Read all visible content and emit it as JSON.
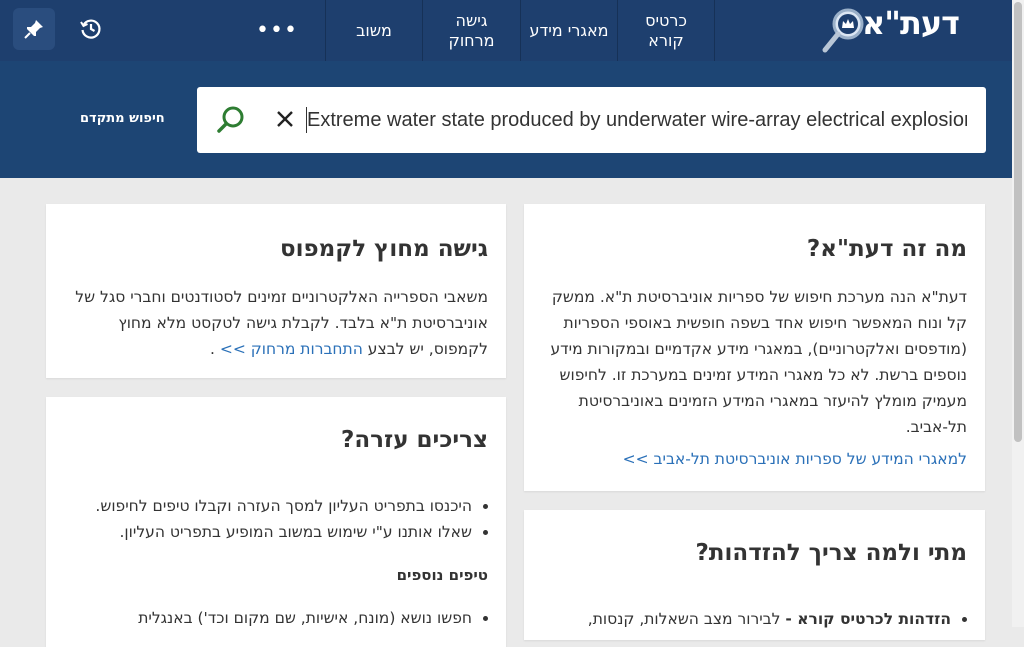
{
  "header": {
    "logo_text": "דעת\"א",
    "nav": [
      {
        "label_line1": "כרטיס",
        "label_line2": "קורא"
      },
      {
        "label_line1": "מאגרי מידע",
        "label_line2": ""
      },
      {
        "label_line1": "גישה",
        "label_line2": "מרחוק"
      },
      {
        "label_line1": "משוב",
        "label_line2": ""
      }
    ],
    "more_label": "•••",
    "icons": {
      "pin": "pin-icon",
      "history": "history-icon",
      "logo": "magnifier-crown-icon"
    }
  },
  "search": {
    "value": "Extreme water state produced by underwater wire-array electrical explosion",
    "advanced_label": "חיפוש מתקדם",
    "go_icon": "search-icon",
    "clear_icon": "close-icon",
    "go_color": "#2e7d32"
  },
  "cards": {
    "about": {
      "title": "מה זה דעת\"א?",
      "lines": [
        "דעת\"א הנה מערכת חיפוש של ספריות אוניברסיטת ת\"א. ממשק",
        "קל ונוח המאפשר חיפוש אחד בשפה חופשית באוספי הספריות",
        "(מודפסים ואלקטרוניים), במאגרי מידע אקדמיים ובמקורות מידע",
        "נוספים ברשת. לא כל מאגרי המידע זמינים במערכת זו. לחיפוש",
        "מעמיק מומלץ להיעזר במאגרי המידע הזמינים באוניברסיטת",
        "תל-אביב."
      ],
      "link": "למאגרי המידע של ספריות אוניברסיטת תל-אביב >>"
    },
    "remote": {
      "title": "גישה מחוץ לקמפוס",
      "line1": "משאבי הספרייה האלקטרוניים זמינים לסטודנטים וחברי סגל של",
      "line2": "אוניברסיטת ת\"א בלבד. לקבלת גישה לטקסט מלא מחוץ",
      "line3_prefix": "לקמפוס, יש לבצע",
      "line3_link": "התחברות מרחוק >>",
      "line3_suffix": "."
    },
    "help": {
      "title": "צריכים עזרה?",
      "items": [
        "היכנסו בתפריט העליון למסך העזרה וקבלו טיפים לחיפוש.",
        "שאלו אותנו ע\"י שימוש במשוב המופיע בתפריט העליון."
      ],
      "tips_title": "טיפים נוספים",
      "tips_items": [
        "חפשו נושא (מונח, אישיות, שם מקום וכד') באנגלית"
      ]
    },
    "identify": {
      "title": "מתי ולמה צריך להזדהות?",
      "item_bold": "הזדהות לכרטיס קורא -",
      "item_text": " לבירור מצב השאלות, קנסות,"
    }
  }
}
